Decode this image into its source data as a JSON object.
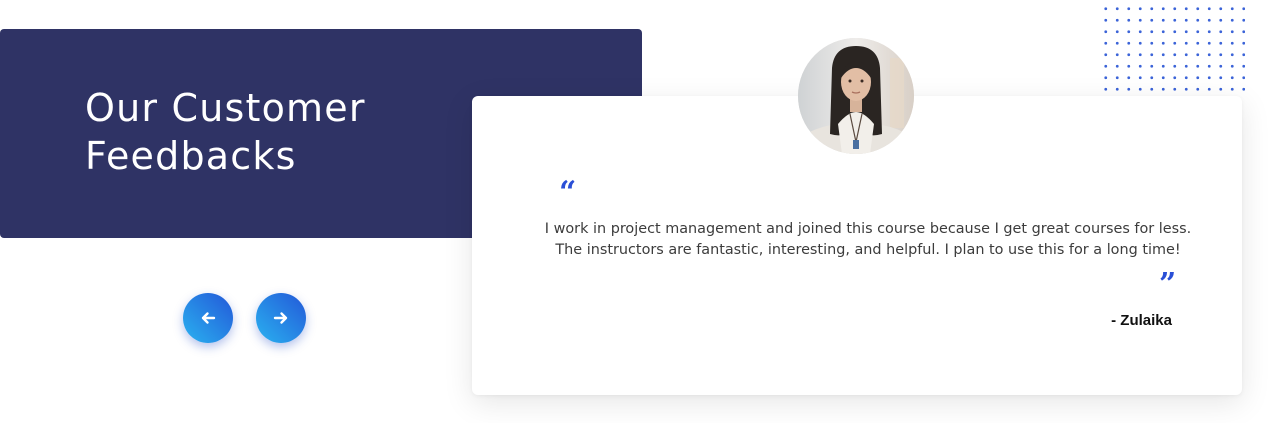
{
  "section": {
    "title_line1": "Our Customer",
    "title_line2": "Feedbacks"
  },
  "navigation": {
    "prev_icon": "arrow-left-icon",
    "next_icon": "arrow-right-icon"
  },
  "testimonial": {
    "open_quote": "“",
    "close_quote": "”",
    "text_line1": "I work in project management and joined this course because I get great courses for less.",
    "text_line2": "The instructors are fantastic, interesting, and helpful. I plan to use this for a long time!",
    "author": "- Zulaika",
    "avatar_icon": "customer-avatar-photo"
  },
  "colors": {
    "panel": "#2f3365",
    "accent": "#2a4fd6",
    "button_gradient_start": "#2ab2f0",
    "button_gradient_end": "#2358d8"
  }
}
